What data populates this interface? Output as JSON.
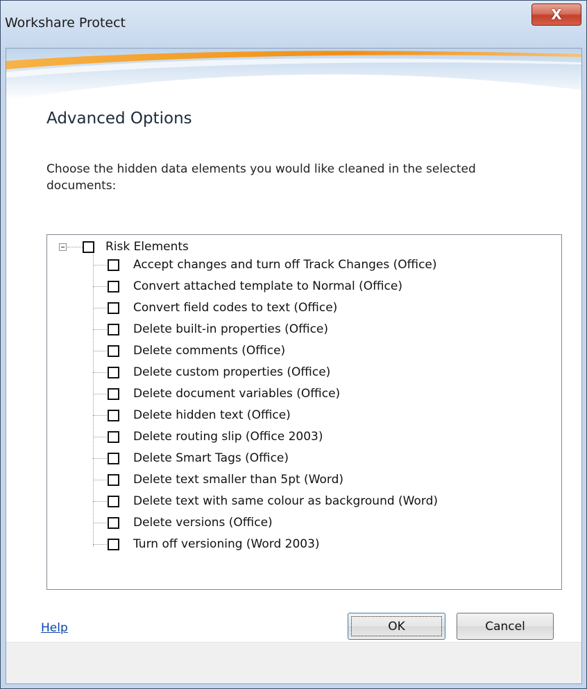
{
  "window": {
    "title": "Workshare Protect",
    "close_glyph": "X",
    "close_icon": "close-icon"
  },
  "main": {
    "heading": "Advanced Options",
    "instruction": "Choose the hidden data elements you would like cleaned in the selected documents:"
  },
  "tree": {
    "root_label": "Risk Elements",
    "root_expanded": true,
    "root_checked": false,
    "items": [
      {
        "label": "Accept changes and turn off Track Changes (Office)",
        "checked": false
      },
      {
        "label": "Convert attached template to Normal (Office)",
        "checked": false
      },
      {
        "label": "Convert field codes to text (Office)",
        "checked": false
      },
      {
        "label": "Delete built-in properties (Office)",
        "checked": false
      },
      {
        "label": "Delete comments (Office)",
        "checked": false
      },
      {
        "label": "Delete custom properties (Office)",
        "checked": false
      },
      {
        "label": "Delete document variables (Office)",
        "checked": false
      },
      {
        "label": "Delete hidden text (Office)",
        "checked": false
      },
      {
        "label": "Delete routing slip (Office 2003)",
        "checked": false
      },
      {
        "label": "Delete Smart Tags (Office)",
        "checked": false
      },
      {
        "label": "Delete text smaller than 5pt (Word)",
        "checked": false
      },
      {
        "label": "Delete text with same colour as background (Word)",
        "checked": false
      },
      {
        "label": "Delete versions (Office)",
        "checked": false
      },
      {
        "label": "Turn off versioning (Word 2003)",
        "checked": false
      }
    ]
  },
  "footer": {
    "help_label": "Help",
    "ok_label": "OK",
    "cancel_label": "Cancel"
  },
  "colors": {
    "banner_orange": "#f39a1e",
    "banner_blue": "#8fb3d9",
    "link": "#0645ad"
  }
}
